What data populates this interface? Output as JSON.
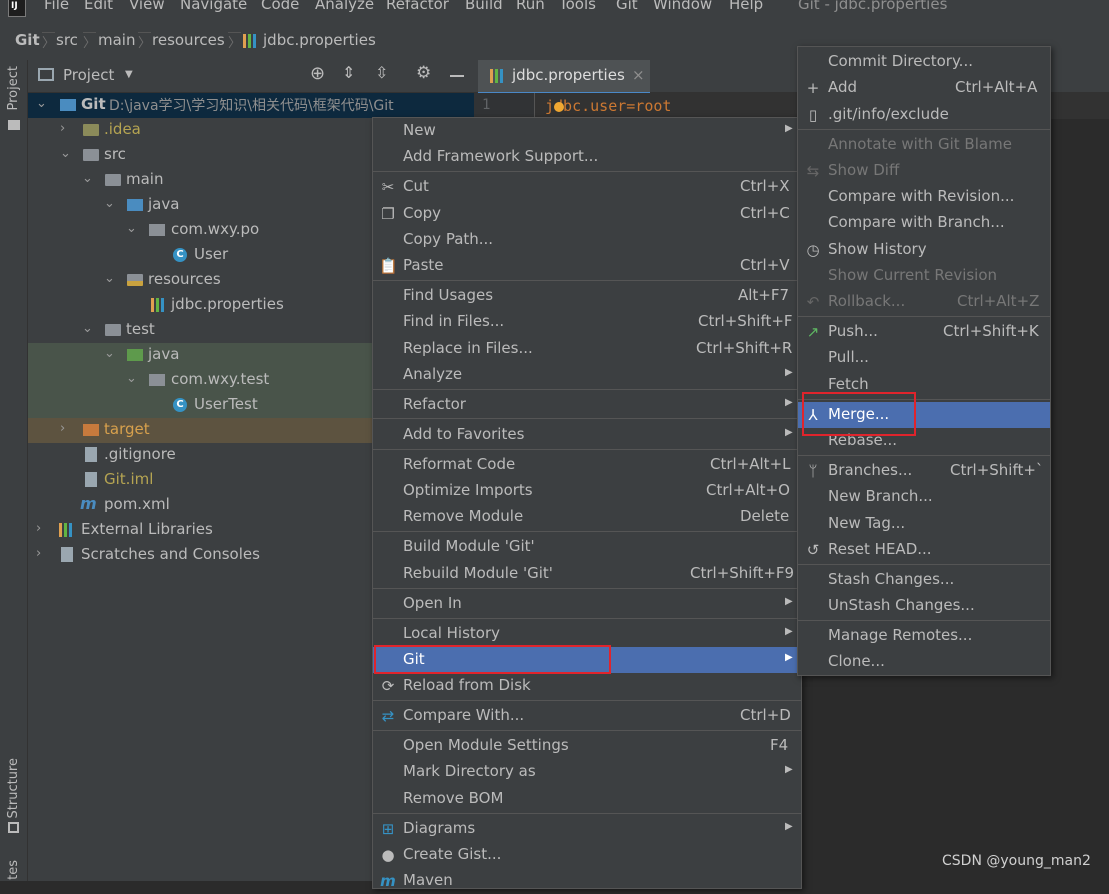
{
  "menubar": {
    "items": [
      "File",
      "Edit",
      "View",
      "Navigate",
      "Code",
      "Analyze",
      "Refactor",
      "Build",
      "Run",
      "Tools",
      "Git",
      "Window",
      "Help"
    ],
    "window_title": "Git - jdbc.properties"
  },
  "breadcrumb": [
    "Git",
    "src",
    "main",
    "resources",
    "jdbc.properties"
  ],
  "sidebar": {
    "project_label": "Project",
    "structure_label": "Structure",
    "bottom_label": "tes"
  },
  "project_panel": {
    "title": "Project"
  },
  "tree": {
    "root": {
      "name": "Git",
      "path": "D:\\java学习\\学习知识\\相关代码\\框架代码\\Git"
    },
    "idea": ".idea",
    "src": "src",
    "main": "main",
    "java": "java",
    "pkg_po": "com.wxy.po",
    "user": "User",
    "resources": "resources",
    "jdbc": "jdbc.properties",
    "test": "test",
    "test_java": "java",
    "pkg_test": "com.wxy.test",
    "usertest": "UserTest",
    "target": "target",
    "gitignore": ".gitignore",
    "gitiml": "Git.iml",
    "pom": "pom.xml",
    "extlibs": "External Libraries",
    "scratches": "Scratches and Consoles"
  },
  "editor": {
    "tab_label": "jdbc.properties",
    "line_number": "1",
    "code_line": "jdbc.user=root"
  },
  "context_menu": {
    "new": "New",
    "add_framework": "Add Framework Support...",
    "cut": "Cut",
    "cut_sc": "Ctrl+X",
    "copy": "Copy",
    "copy_sc": "Ctrl+C",
    "copy_path": "Copy Path...",
    "paste": "Paste",
    "paste_sc": "Ctrl+V",
    "find_usages": "Find Usages",
    "find_usages_sc": "Alt+F7",
    "find_in_files": "Find in Files...",
    "find_in_files_sc": "Ctrl+Shift+F",
    "replace_in_files": "Replace in Files...",
    "replace_in_files_sc": "Ctrl+Shift+R",
    "analyze": "Analyze",
    "refactor": "Refactor",
    "add_favorites": "Add to Favorites",
    "reformat": "Reformat Code",
    "reformat_sc": "Ctrl+Alt+L",
    "optimize": "Optimize Imports",
    "optimize_sc": "Ctrl+Alt+O",
    "remove_module": "Remove Module",
    "remove_module_sc": "Delete",
    "build_module": "Build Module 'Git'",
    "rebuild_module": "Rebuild Module 'Git'",
    "rebuild_module_sc": "Ctrl+Shift+F9",
    "open_in": "Open In",
    "local_history": "Local History",
    "git": "Git",
    "reload": "Reload from Disk",
    "compare_with": "Compare With...",
    "compare_with_sc": "Ctrl+D",
    "open_module_settings": "Open Module Settings",
    "open_module_settings_sc": "F4",
    "mark_dir": "Mark Directory as",
    "remove_bom": "Remove BOM",
    "diagrams": "Diagrams",
    "create_gist": "Create Gist...",
    "maven": "Maven"
  },
  "git_menu": {
    "commit_dir": "Commit Directory...",
    "add": "Add",
    "add_sc": "Ctrl+Alt+A",
    "exclude": ".git/info/exclude",
    "annotate": "Annotate with Git Blame",
    "show_diff": "Show Diff",
    "compare_revision": "Compare with Revision...",
    "compare_branch": "Compare with Branch...",
    "show_history": "Show History",
    "show_current_revision": "Show Current Revision",
    "rollback": "Rollback...",
    "rollback_sc": "Ctrl+Alt+Z",
    "push": "Push...",
    "push_sc": "Ctrl+Shift+K",
    "pull": "Pull...",
    "fetch": "Fetch",
    "merge": "Merge...",
    "rebase": "Rebase...",
    "branches": "Branches...",
    "branches_sc": "Ctrl+Shift+`",
    "new_branch": "New Branch...",
    "new_tag": "New Tag...",
    "reset_head": "Reset HEAD...",
    "stash": "Stash Changes...",
    "unstash": "UnStash Changes...",
    "manage_remotes": "Manage Remotes...",
    "clone": "Clone..."
  },
  "watermark": "CSDN @young_man2",
  "colors": {
    "highlight": "#4b6eaf",
    "annotation": "#e0242c",
    "menu_bg": "#3c3f41"
  }
}
